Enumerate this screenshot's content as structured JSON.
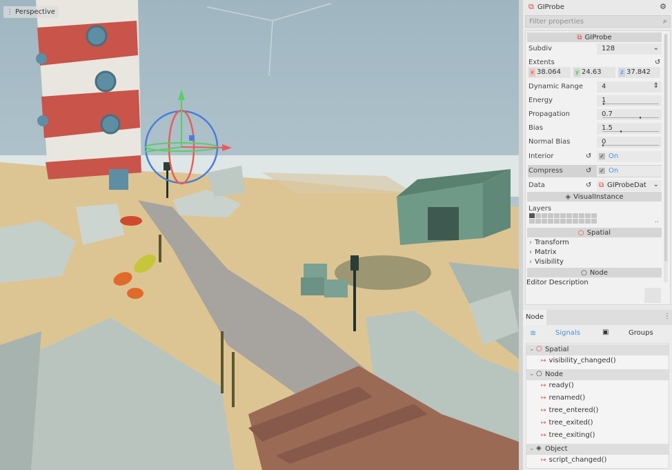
{
  "viewport": {
    "mode_label": "Perspective"
  },
  "inspector": {
    "title": "GIProbe",
    "filter_placeholder": "Filter properties",
    "class_header": "GIProbe",
    "subdiv": {
      "label": "Subdiv",
      "value": "128"
    },
    "extents": {
      "label": "Extents",
      "x": "38.064",
      "y": "24.63",
      "z": "37.842",
      "x_axis": "x",
      "y_axis": "y",
      "z_axis": "z"
    },
    "dynamic_range": {
      "label": "Dynamic Range",
      "value": "4"
    },
    "energy": {
      "label": "Energy",
      "value": "1"
    },
    "propagation": {
      "label": "Propagation",
      "value": "0.7"
    },
    "bias": {
      "label": "Bias",
      "value": "1.5"
    },
    "normal_bias": {
      "label": "Normal Bias",
      "value": "0"
    },
    "interior": {
      "label": "Interior",
      "value": "On"
    },
    "compress": {
      "label": "Compress",
      "value": "On"
    },
    "data": {
      "label": "Data",
      "value": "GIProbeDat"
    },
    "visual_instance_header": "VisualInstance",
    "layers_label": "Layers",
    "layers_more": "..",
    "spatial_header": "Spatial",
    "transform": "Transform",
    "matrix": "Matrix",
    "visibility": "Visibility",
    "node_header": "Node",
    "editor_description": "Editor Description"
  },
  "node_panel": {
    "tab": "Node",
    "signals_tab": "Signals",
    "groups_tab": "Groups",
    "classes": [
      {
        "name": "Spatial",
        "signals": [
          "visibility_changed()"
        ]
      },
      {
        "name": "Node",
        "signals": [
          "ready()",
          "renamed()",
          "tree_entered()",
          "tree_exited()",
          "tree_exiting()"
        ]
      },
      {
        "name": "Object",
        "signals": [
          "script_changed()"
        ]
      }
    ]
  },
  "colors": {
    "accent": "#4a8fd6",
    "node_icon": "#e0433a",
    "sand": "#dcc593",
    "rock": "#c9d2cd",
    "sky": "#a9bec7"
  }
}
